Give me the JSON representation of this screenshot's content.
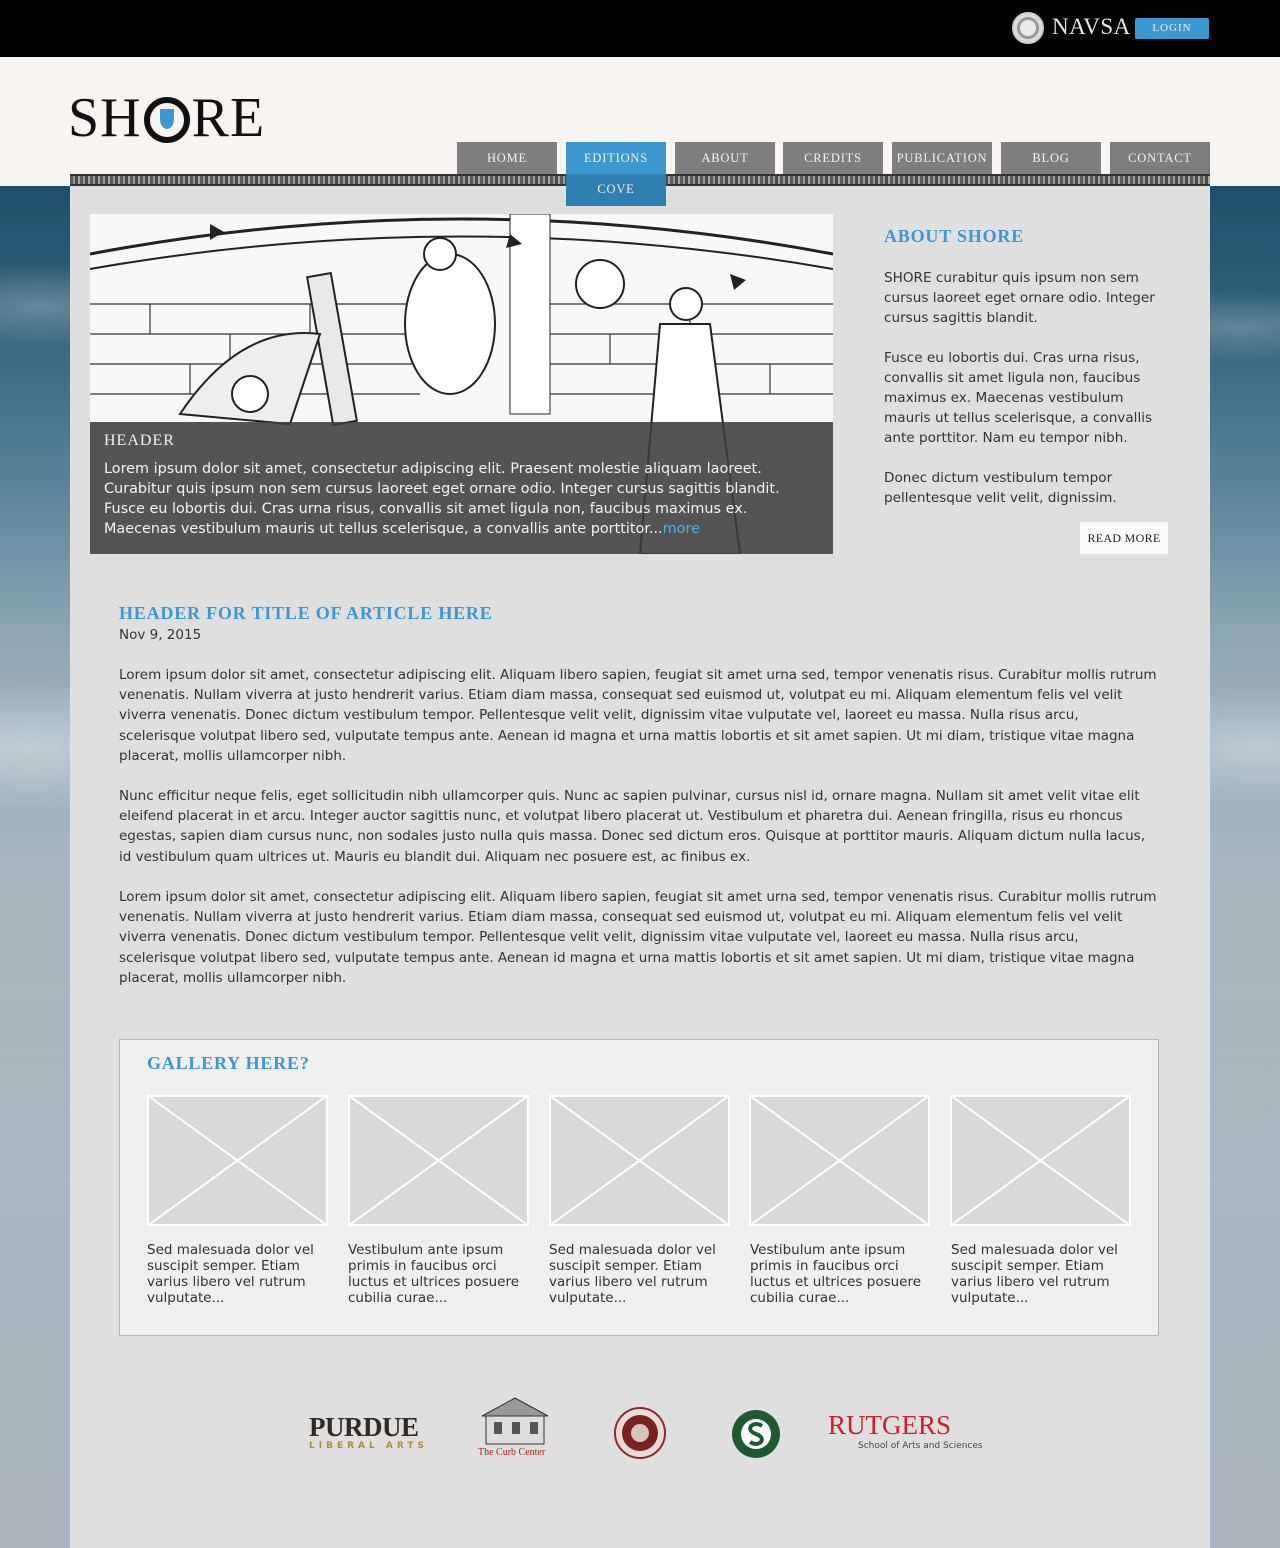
{
  "topbar": {
    "org_name": "NAVSA",
    "login_label": "LOGIN"
  },
  "brand": {
    "logo_left": "SH",
    "logo_right": "RE"
  },
  "nav": {
    "items": [
      {
        "label": "HOME"
      },
      {
        "label": "EDITIONS"
      },
      {
        "label": "ABOUT"
      },
      {
        "label": "CREDITS"
      },
      {
        "label": "PUBLICATION"
      },
      {
        "label": "BLOG"
      },
      {
        "label": "CONTACT"
      }
    ],
    "active": "EDITIONS",
    "submenu": [
      {
        "label": "COVE"
      }
    ]
  },
  "hero": {
    "title": "HEADER",
    "text": "Lorem ipsum dolor sit amet, consectetur adipiscing elit. Praesent molestie aliquam laoreet. Curabitur quis ipsum non sem cursus laoreet eget ornare odio. Integer cursus sagittis blandit. Fusce eu lobortis dui. Cras urna risus, convallis sit amet ligula non, faucibus maximus ex. Maecenas vestibulum mauris ut tellus scelerisque, a convallis ante porttitor...",
    "more_label": "more"
  },
  "about": {
    "title": "ABOUT SHORE",
    "paragraphs": [
      "SHORE curabitur quis ipsum non sem cursus laoreet eget ornare odio. Integer cursus sagittis blandit.",
      "Fusce eu lobortis dui. Cras urna risus, convallis sit amet ligula non, faucibus maximus ex. Maecenas vestibulum mauris ut tellus scelerisque, a convallis ante porttitor. Nam eu tempor nibh.",
      "Donec dictum vestibulum tempor pellentesque velit velit, dignissim."
    ],
    "read_more_label": "READ MORE"
  },
  "article": {
    "title": "HEADER FOR TITLE OF ARTICLE HERE",
    "date": "Nov 9, 2015",
    "paragraphs": [
      "Lorem ipsum dolor sit amet, consectetur adipiscing elit. Aliquam libero sapien, feugiat sit amet urna sed, tempor venenatis risus. Curabitur mollis rutrum venenatis. Nullam viverra at justo hendrerit varius. Etiam diam massa, consequat sed euismod ut, volutpat eu mi. Aliquam elementum felis vel velit viverra venenatis. Donec dictum vestibulum tempor. Pellentesque velit velit, dignissim vitae vulputate vel, laoreet eu massa. Nulla risus arcu, scelerisque volutpat libero sed, vulputate tempus ante. Aenean id magna et urna mattis lobortis et sit amet sapien. Ut mi diam, tristique vitae magna placerat, mollis ullamcorper nibh.",
      "Nunc efficitur neque felis, eget sollicitudin nibh ullamcorper quis. Nunc ac sapien pulvinar, cursus nisl id, ornare magna. Nullam sit amet velit vitae elit eleifend placerat in et arcu. Integer auctor sagittis nunc, et volutpat libero placerat ut. Vestibulum et pharetra dui. Aenean fringilla, risus eu rhoncus egestas, sapien diam cursus nunc, non sodales justo nulla quis massa. Donec sed dictum eros. Quisque at porttitor mauris. Aliquam dictum nulla lacus, id vestibulum quam ultrices ut. Mauris eu blandit dui. Aliquam nec posuere est, ac finibus ex.",
      "Lorem ipsum dolor sit amet, consectetur adipiscing elit. Aliquam libero sapien, feugiat sit amet urna sed, tempor venenatis risus. Curabitur mollis rutrum venenatis. Nullam viverra at justo hendrerit varius. Etiam diam massa, consequat sed euismod ut, volutpat eu mi. Aliquam elementum felis vel velit viverra venenatis. Donec dictum vestibulum tempor. Pellentesque velit velit, dignissim vitae vulputate vel, laoreet eu massa. Nulla risus arcu, scelerisque volutpat libero sed, vulputate tempus ante. Aenean id magna et urna mattis lobortis et sit amet sapien. Ut mi diam, tristique vitae magna placerat, mollis ullamcorper nibh."
    ]
  },
  "gallery": {
    "title": "GALLERY HERE?",
    "items": [
      {
        "caption": "Sed malesuada dolor vel suscipit semper. Etiam varius libero vel rutrum vulputate..."
      },
      {
        "caption": "Vestibulum ante ipsum primis in faucibus orci luctus et ultrices posuere cubilia curae..."
      },
      {
        "caption": "Sed malesuada dolor vel suscipit semper. Etiam varius libero vel rutrum vulputate..."
      },
      {
        "caption": "Vestibulum ante ipsum primis in faucibus orci luctus et ultrices posuere cubilia curae..."
      },
      {
        "caption": "Sed malesuada dolor vel suscipit semper. Etiam varius libero vel rutrum vulputate..."
      }
    ]
  },
  "sponsors": {
    "purdue": {
      "name": "PURDUE",
      "sub": "LIBERAL ARTS"
    },
    "curb": {
      "name": "The Curb Center"
    },
    "rutgers": {
      "name": "RUTGERS",
      "sub": "School of Arts and Sciences"
    },
    "icons": [
      "curb-center-logo",
      "seal-logo",
      "s-circle-logo"
    ]
  },
  "colors": {
    "accent": "#3d97d0",
    "nav_bg": "#7e7e7e",
    "topbar": "#030303",
    "panel": "#dfdfdf"
  }
}
